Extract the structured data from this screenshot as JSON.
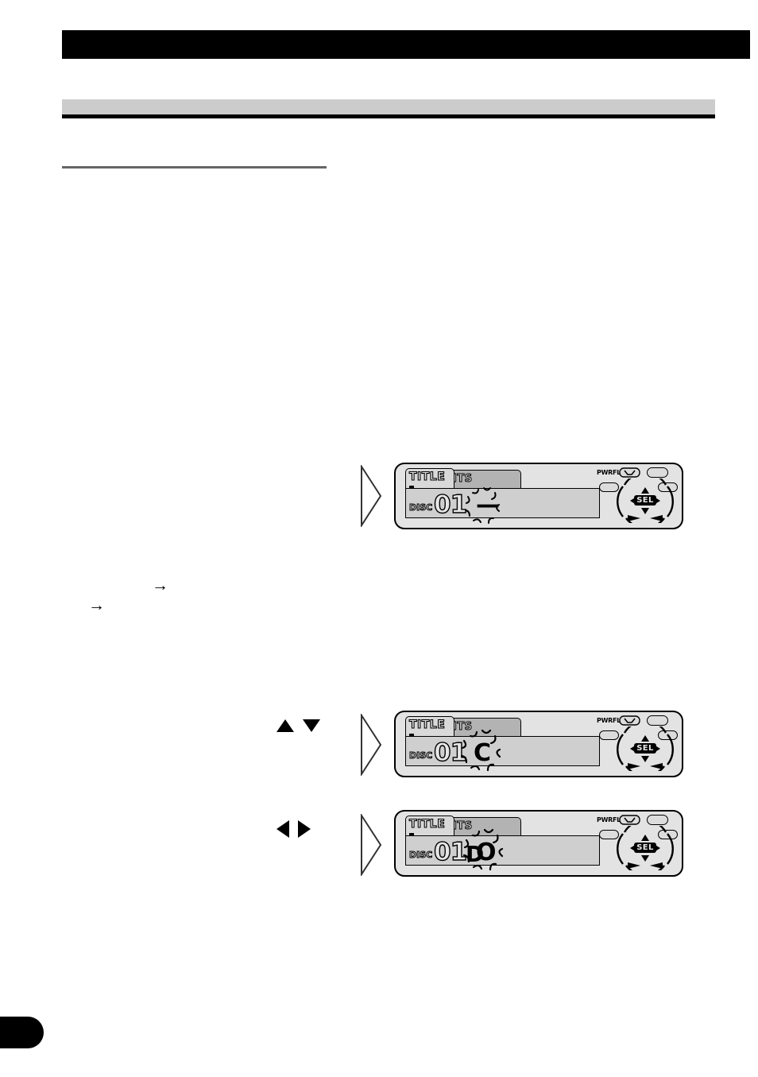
{
  "page": {
    "header_bar": {
      "title": ""
    },
    "section_band": {
      "label": ""
    },
    "page_tab": {
      "number": ""
    }
  },
  "colors": {
    "header_bar": "#000000",
    "section_band": "#cccccc",
    "section_rule": "#000000",
    "sub_rule": "#666666",
    "unit_body": "#e3e3e3",
    "lcd_field": "#cfcfcf",
    "tab_active": "#d9d9d9",
    "tab_inactive": "#b3b3b3",
    "sel_badge": "#000000"
  },
  "body_text": {
    "arrow_1": "→",
    "arrow_2": "→"
  },
  "key_hints": [
    {
      "id": "up-down",
      "up": "▲",
      "down": "▼"
    },
    {
      "id": "left-right",
      "left": "◀",
      "right": "▶"
    }
  ],
  "units": [
    {
      "id": "unit-1",
      "tab_title": "TITLE",
      "tab_its": "ITS",
      "lcd": {
        "disc_label": "DISC",
        "disc_number": "01",
        "static_char": "",
        "flashing_char": "—"
      },
      "controls": {
        "pwrfl_label": "PWRFL",
        "sel_label": "SEL",
        "up": "▲",
        "down": "▼",
        "left": "◀",
        "right": "▶"
      }
    },
    {
      "id": "unit-2",
      "tab_title": "TITLE",
      "tab_its": "ITS",
      "lcd": {
        "disc_label": "DISC",
        "disc_number": "01",
        "static_char": "",
        "flashing_char": "C"
      },
      "controls": {
        "pwrfl_label": "PWRFL",
        "sel_label": "SEL",
        "up": "▲",
        "down": "▼",
        "left": "◀",
        "right": "▶"
      }
    },
    {
      "id": "unit-3",
      "tab_title": "TITLE",
      "tab_its": "ITS",
      "lcd": {
        "disc_label": "DISC",
        "disc_number": "01",
        "static_char": "D",
        "flashing_char": "O"
      },
      "controls": {
        "pwrfl_label": "PWRFL",
        "sel_label": "SEL",
        "up": "▲",
        "down": "▼",
        "left": "◀",
        "right": "▶"
      }
    }
  ]
}
